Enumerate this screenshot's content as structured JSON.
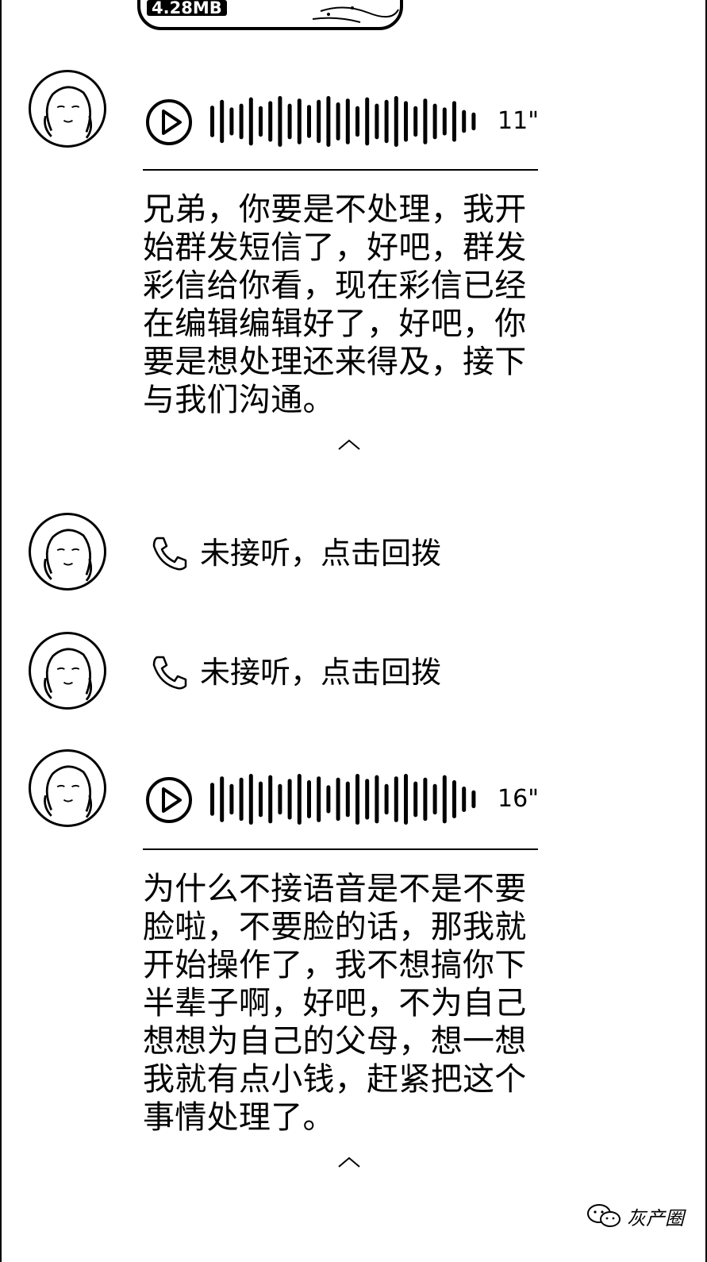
{
  "file_bubble": {
    "size": "4.28MB"
  },
  "messages": [
    {
      "type": "voice",
      "duration": "11\"",
      "transcript": "兄弟，你要是不处理，我开始群发短信了，好吧，群发彩信给你看，现在彩信已经在编辑编辑好了，好吧，你要是想处理还来得及，接下与我们沟通。",
      "transcript_lines": [
        "兄弟，你要是不处理，我开",
        "始群发短信了，好吧，群发",
        "彩信给你看，现在彩信已经",
        "在编辑编辑好了，好吧，你",
        "要是想处理还来得及，接下",
        "与我们沟通。"
      ]
    },
    {
      "type": "missed_call",
      "label": "未接听，点击回拨"
    },
    {
      "type": "missed_call",
      "label": "未接听，点击回拨"
    },
    {
      "type": "voice",
      "duration": "16\"",
      "transcript_lines": [
        "为什么不接语音是不是不要",
        "脸啦，不要脸的话，那我就",
        "开始操作了，我不想搞你下",
        "半辈子啊，好吧，不为自己",
        "想想为自己的父母，想一想",
        "我就有点小钱，赶紧把这个",
        "事情处理了。"
      ]
    }
  ],
  "watermark": {
    "text": "灰产圈"
  },
  "icons": {
    "play": "play-circle-icon",
    "phone": "phone-icon",
    "collapse": "chevron-up-icon",
    "watermark": "wechat-icon"
  },
  "colors": {
    "foreground": "#000000",
    "background": "#ffffff"
  }
}
